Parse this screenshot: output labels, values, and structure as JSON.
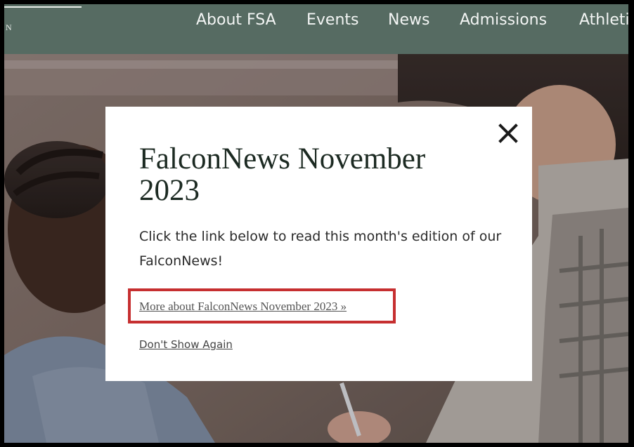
{
  "header": {
    "logo_fragment": "N",
    "nav": [
      {
        "label": "About FSA"
      },
      {
        "label": "Events"
      },
      {
        "label": "News"
      },
      {
        "label": "Admissions"
      },
      {
        "label": "Athleti"
      }
    ]
  },
  "modal": {
    "title": "FalconNews November 2023",
    "body": "Click the link below to read this month's edition of our FalconNews!",
    "link_label": "More about FalconNews November 2023 »",
    "dont_show_label": "Don't Show Again",
    "close_icon": "close-icon",
    "highlight_color": "#c62f30"
  },
  "colors": {
    "nav_background": "#566b62",
    "nav_text": "#f3f5f4",
    "title_text": "#1c2a22"
  }
}
